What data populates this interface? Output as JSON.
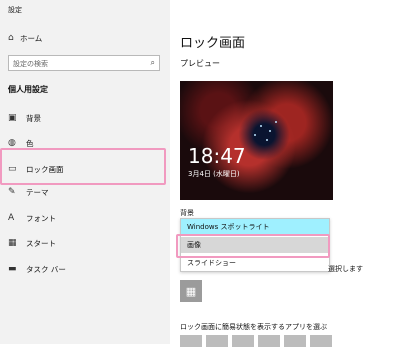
{
  "app_title": "設定",
  "home": {
    "label": "ホーム",
    "icon": "home-icon"
  },
  "search": {
    "placeholder": "設定の検索",
    "icon": "search-icon"
  },
  "section_label": "個人用設定",
  "nav_items": [
    {
      "label": "背景",
      "icon": "picture-icon"
    },
    {
      "label": "色",
      "icon": "palette-icon"
    },
    {
      "label": "ロック画面",
      "icon": "lock-screen-icon"
    },
    {
      "label": "テーマ",
      "icon": "theme-icon"
    },
    {
      "label": "フォント",
      "icon": "font-icon"
    },
    {
      "label": "スタート",
      "icon": "start-icon"
    },
    {
      "label": "タスク バー",
      "icon": "taskbar-icon"
    }
  ],
  "main": {
    "title": "ロック画面",
    "preview_label": "プレビュー",
    "clock": "18:47",
    "date": "3月4日 (水曜日)",
    "background_label": "背景",
    "options": [
      "Windows スポットライト",
      "画像",
      "スライドショー"
    ],
    "trailing_text": "選択します",
    "calendar_icon": "calendar-icon",
    "bottom_label": "ロック画面に簡易状態を表示するアプリを選ぶ"
  },
  "colors": {
    "highlight": "#f19ac0",
    "spotlight_option": "#9ff0ff"
  }
}
